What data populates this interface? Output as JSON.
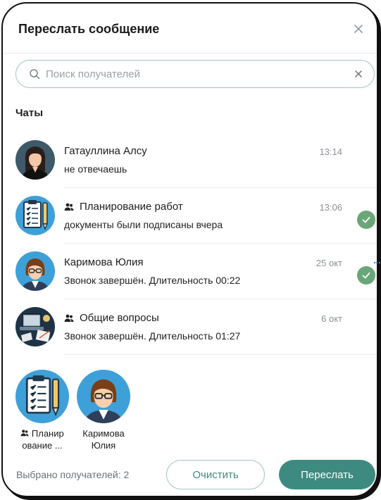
{
  "dialog": {
    "title": "Переслать сообщение",
    "close_icon": "close-icon"
  },
  "search": {
    "placeholder": "Поиск получателей",
    "value": "",
    "icon": "search-icon",
    "clear_icon": "close-icon"
  },
  "chats_section": {
    "title": "Чаты",
    "items": [
      {
        "name": "Гатауллина Алсу",
        "message": "не отвечаешь",
        "time": "13:14",
        "is_group": false,
        "selected": false,
        "avatar": "woman-avatar"
      },
      {
        "name": "Планирование работ",
        "message": "документы были подписаны вчера",
        "time": "13:06",
        "is_group": true,
        "selected": true,
        "avatar": "checklist-avatar"
      },
      {
        "name": "Каримова Юлия",
        "message": "Звонок завершён. Длительность 00:22",
        "time": "25 окт",
        "is_group": false,
        "selected": true,
        "avatar": "woman-glasses-avatar"
      },
      {
        "name": "Общие вопросы",
        "message": "Звонок завершён. Длительность 01:27",
        "time": "6 окт",
        "is_group": true,
        "selected": false,
        "avatar": "desk-avatar"
      }
    ]
  },
  "selected_recipients": [
    {
      "label_line1": "Планир",
      "label_line2": "ование ...",
      "is_group": true,
      "avatar": "checklist-avatar"
    },
    {
      "label_line1": "Каримова",
      "label_line2": "Юлия",
      "is_group": false,
      "avatar": "woman-glasses-avatar"
    }
  ],
  "footer": {
    "selected_count_text": "Выбрано получателей: 2",
    "clear_label": "Очистить",
    "forward_label": "Переслать"
  },
  "colors": {
    "accent": "#3d8b80",
    "check": "#6aa678",
    "border": "#9fc4c2"
  }
}
